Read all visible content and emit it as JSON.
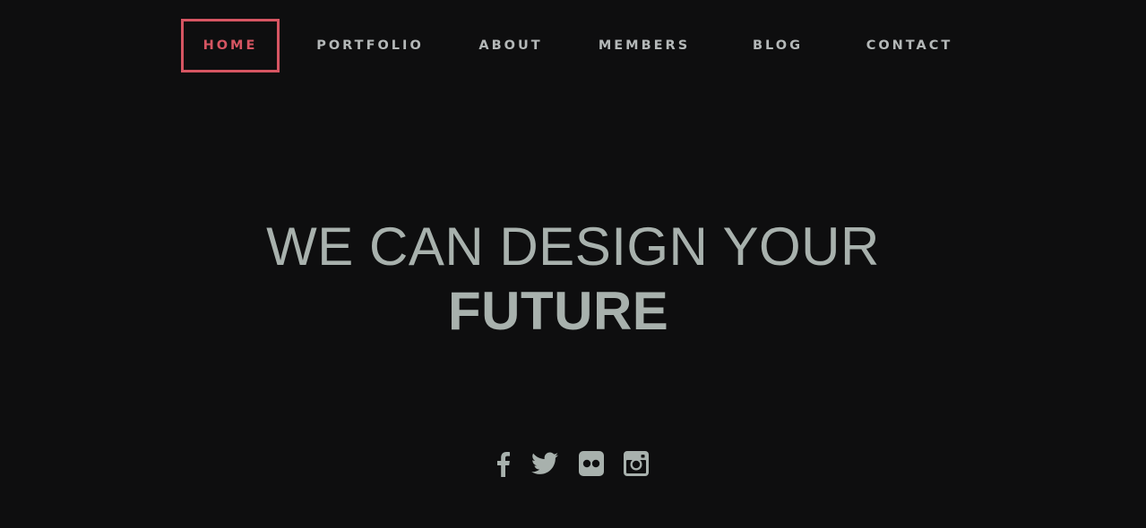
{
  "nav": {
    "items": [
      {
        "label": "HOME",
        "active": true
      },
      {
        "label": "PORTFOLIO",
        "active": false
      },
      {
        "label": "ABOUT",
        "active": false
      },
      {
        "label": "MEMBERS",
        "active": false
      },
      {
        "label": "BLOG",
        "active": false
      },
      {
        "label": "CONTACT",
        "active": false
      }
    ]
  },
  "hero": {
    "line1": "WE CAN DESIGN YOUR",
    "line2": "FUTURE"
  },
  "social": {
    "icons": [
      "facebook-icon",
      "twitter-icon",
      "flickr-icon",
      "instagram-icon"
    ]
  },
  "colors": {
    "background": "#0e0e0f",
    "accent": "#d65562",
    "text": "#a8b1ad",
    "nav_text": "#b4b8b8"
  }
}
